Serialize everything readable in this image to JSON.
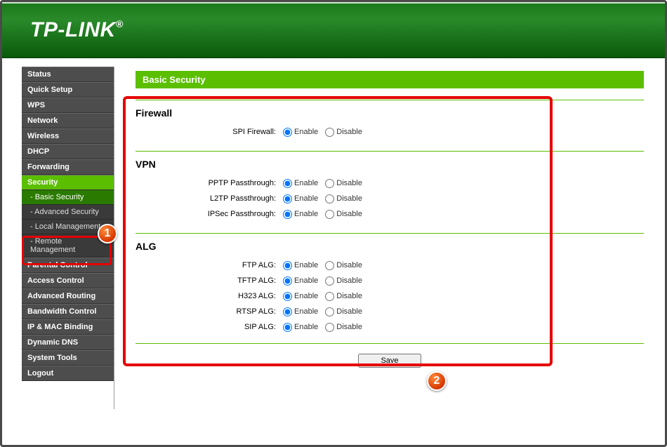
{
  "brand": {
    "name": "TP-LINK",
    "reg": "®"
  },
  "sidebar": {
    "items": [
      {
        "label": "Status"
      },
      {
        "label": "Quick Setup"
      },
      {
        "label": "WPS"
      },
      {
        "label": "Network"
      },
      {
        "label": "Wireless"
      },
      {
        "label": "DHCP"
      },
      {
        "label": "Forwarding"
      },
      {
        "label": "Security",
        "active": true
      },
      {
        "label": "- Basic Security",
        "sub": true,
        "subactive": true
      },
      {
        "label": "- Advanced Security",
        "sub": true
      },
      {
        "label": "- Local Management",
        "sub": true
      },
      {
        "label": "- Remote Management",
        "sub": true
      },
      {
        "label": "Parental Control"
      },
      {
        "label": "Access Control"
      },
      {
        "label": "Advanced Routing"
      },
      {
        "label": "Bandwidth Control"
      },
      {
        "label": "IP & MAC Binding"
      },
      {
        "label": "Dynamic DNS"
      },
      {
        "label": "System Tools"
      },
      {
        "label": "Logout"
      }
    ]
  },
  "page": {
    "title": "Basic Security"
  },
  "opts": {
    "enable": "Enable",
    "disable": "Disable"
  },
  "firewall": {
    "heading": "Firewall",
    "spi_label": "SPI Firewall:"
  },
  "vpn": {
    "heading": "VPN",
    "pptp_label": "PPTP Passthrough:",
    "l2tp_label": "L2TP Passthrough:",
    "ipsec_label": "IPSec Passthrough:"
  },
  "alg": {
    "heading": "ALG",
    "ftp_label": "FTP ALG:",
    "tftp_label": "TFTP ALG:",
    "h323_label": "H323 ALG:",
    "rtsp_label": "RTSP ALG:",
    "sip_label": "SIP ALG:"
  },
  "buttons": {
    "save": "Save"
  },
  "badges": {
    "one": "1",
    "two": "2"
  }
}
